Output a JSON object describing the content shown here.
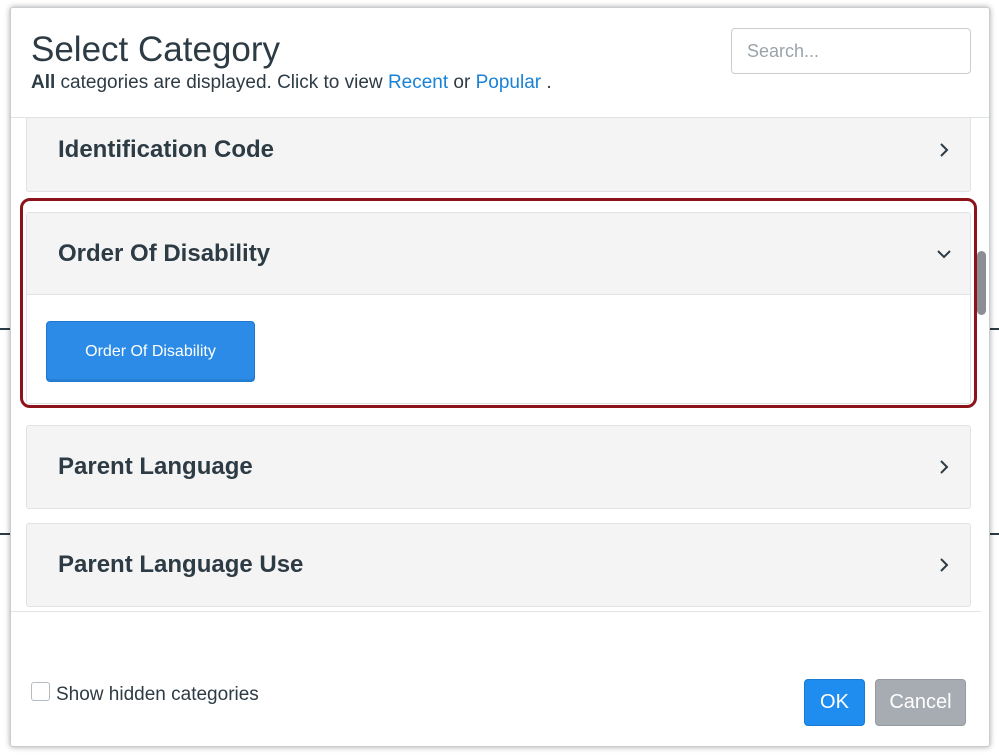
{
  "dialog": {
    "title": "Select Category",
    "subtitle": {
      "bold": "All",
      "text": " categories are displayed. Click to view ",
      "recent": "Recent",
      "or": " or ",
      "popular": "Popular",
      "end": " ."
    },
    "search_placeholder": "Search..."
  },
  "categories": [
    {
      "label": "Identification Code",
      "expanded": false
    },
    {
      "label": "Order Of Disability",
      "expanded": true,
      "option": "Order Of Disability"
    },
    {
      "label": "Parent Language",
      "expanded": false
    },
    {
      "label": "Parent Language Use",
      "expanded": false
    }
  ],
  "footer": {
    "show_hidden_label": "Show hidden categories",
    "ok_label": "OK",
    "cancel_label": "Cancel"
  },
  "colors": {
    "accent": "#2b8be6",
    "highlight": "#8b1319",
    "text": "#2d3b45"
  }
}
